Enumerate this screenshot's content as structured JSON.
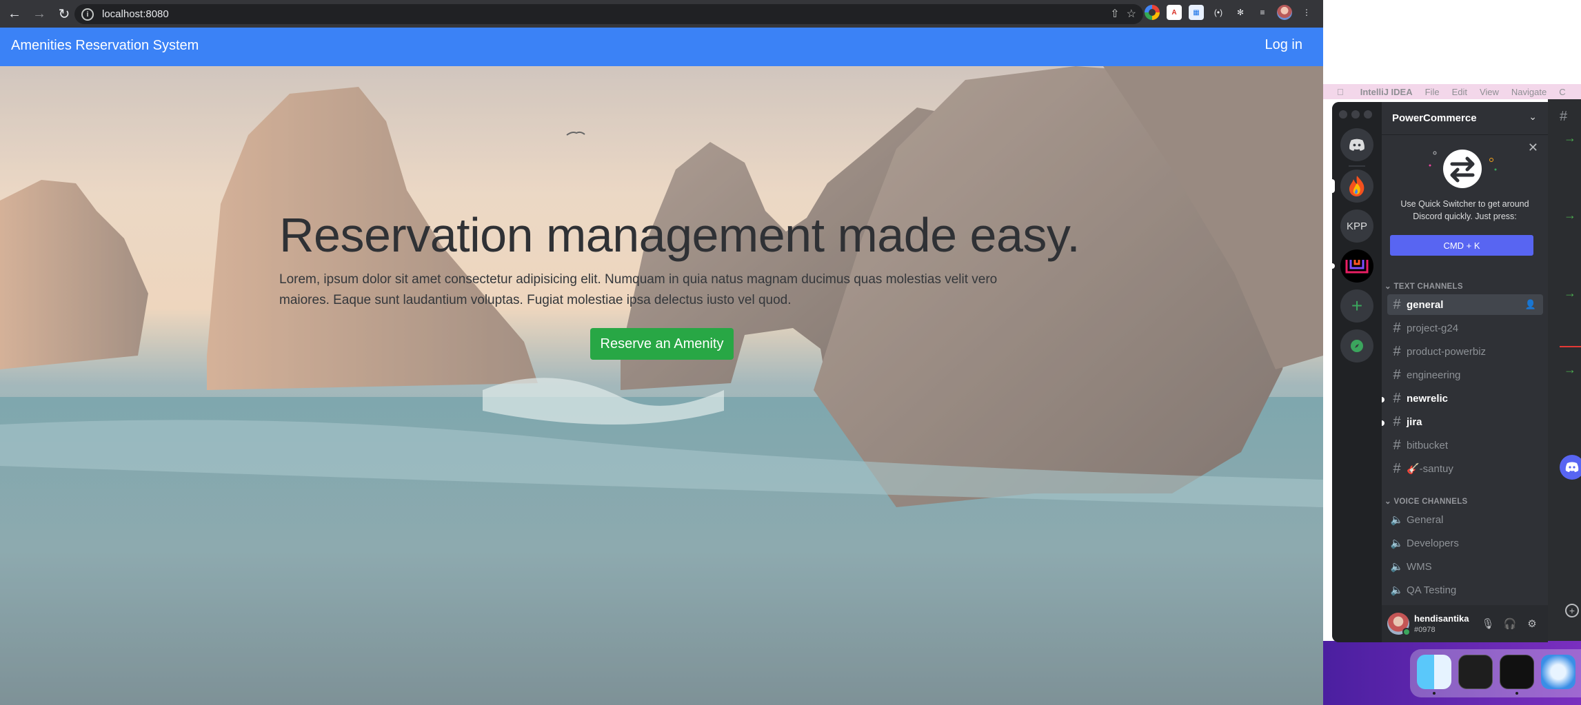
{
  "browser": {
    "url": "localhost:8080",
    "nav": {
      "back_icon": "arrow-left",
      "forward_icon": "arrow-right",
      "reload_icon": "reload"
    }
  },
  "app": {
    "brand": "Amenities Reservation System",
    "login": "Log in",
    "hero": {
      "title": "Reservation management made easy.",
      "text": "Lorem, ipsum dolor sit amet consectetur adipisicing elit. Numquam in quia natus magnam ducimus quas molestias velit vero maiores. Eaque sunt laudantium voluptas. Fugiat molestiae ipsa delectus iusto vel quod.",
      "button": "Reserve an Amenity"
    },
    "colors": {
      "navbar": "#3b82f6",
      "button": "#28a745"
    }
  },
  "macos": {
    "menubar": {
      "app": "IntelliJ IDEA",
      "items": [
        "File",
        "Edit",
        "View",
        "Navigate",
        "C"
      ]
    }
  },
  "discord": {
    "server_name": "PowerCommerce",
    "servers": [
      {
        "name": "home"
      },
      {
        "name": "fire-server"
      },
      {
        "name": "KPP",
        "label": "KPP"
      },
      {
        "name": "logo-server"
      },
      {
        "name": "add-server"
      },
      {
        "name": "explore"
      }
    ],
    "quick_switcher": {
      "text": "Use Quick Switcher to get around Discord quickly. Just press:",
      "button": "CMD + K"
    },
    "text_channels_header": "TEXT CHANNELS",
    "text_channels": [
      {
        "name": "general",
        "state": "active"
      },
      {
        "name": "project-g24",
        "state": "normal"
      },
      {
        "name": "product-powerbiz",
        "state": "normal"
      },
      {
        "name": "engineering",
        "state": "normal"
      },
      {
        "name": "newrelic",
        "state": "unread"
      },
      {
        "name": "jira",
        "state": "unread"
      },
      {
        "name": "bitbucket",
        "state": "normal"
      },
      {
        "name": "🎸-santuy",
        "state": "normal"
      }
    ],
    "voice_channels_header": "VOICE CHANNELS",
    "voice_channels": [
      "General",
      "Developers",
      "WMS",
      "QA Testing"
    ],
    "user": {
      "name": "hendisantika",
      "tag": "#0978"
    }
  }
}
